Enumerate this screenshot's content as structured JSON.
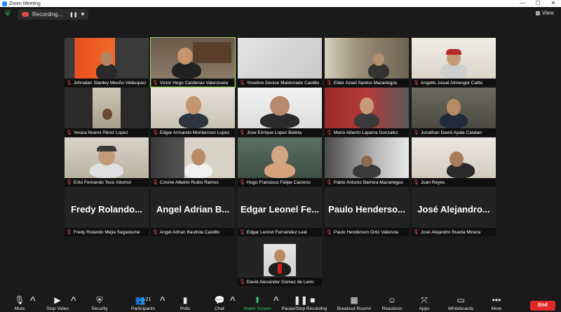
{
  "window": {
    "title": "Zoom Meeting",
    "minimize": "—",
    "maximize": "☐",
    "close": "✕"
  },
  "topbar": {
    "recording_label": "Recording...",
    "view_label": "View"
  },
  "participants": [
    {
      "name": "Johnatan Stanley Meoño Velásquez",
      "muted": true
    },
    {
      "name": "Victor Hugo Cardenas Valenzuela",
      "muted": true,
      "active": true
    },
    {
      "name": "Yoseline Denise Maldonado Castillo",
      "muted": true
    },
    {
      "name": "Elder Azael Santos Mazariegos",
      "muted": true
    },
    {
      "name": "Angello Josué Almengor Calito",
      "muted": true
    },
    {
      "name": "Yesica Noemi Pérez Lopez",
      "muted": true
    },
    {
      "name": "Edgar Armando Monterroso Lopez",
      "muted": true
    },
    {
      "name": "Jose Enrique Lopez Beteta",
      "muted": true
    },
    {
      "name": "Mario Alberto Laparra Gonzalez",
      "muted": true
    },
    {
      "name": "Jonathan David Ayala Catalan",
      "muted": true
    },
    {
      "name": "Erito Fernando Tecú Xitumul",
      "muted": true
    },
    {
      "name": "Cosme Alberto Rubio Ramos",
      "muted": true
    },
    {
      "name": "Hugo Francisco Felipe Caceros",
      "muted": true
    },
    {
      "name": "Pablo Antonio Barrera Mazariegos",
      "muted": true
    },
    {
      "name": "Juan Reyes",
      "muted": true
    },
    {
      "name": "Fredy Rolando Mejia Sagastume",
      "big": "Fredy Rolando...",
      "muted": true
    },
    {
      "name": "Angel Adrian Bautista Castillo",
      "big": "Angel Adrian B...",
      "muted": true
    },
    {
      "name": "Edgar Leonel Fernández Leal",
      "big": "Edgar Leonel Fe...",
      "muted": true
    },
    {
      "name": "Paulo Henderson Ortiz Valencia",
      "big": "Paulo Henderso...",
      "muted": true
    },
    {
      "name": "José Alejandro Rueda Minera",
      "big": "José Alejandro...",
      "muted": true
    },
    {
      "name": "David Alexander Gómez de León",
      "muted": true
    }
  ],
  "toolbar": {
    "mute": "Mute",
    "stop_video": "Stop Video",
    "security": "Security",
    "participants": "Participants",
    "participants_count": "21",
    "polls": "Polls",
    "chat": "Chat",
    "share_screen": "Share Screen",
    "pause_recording": "Pause/Stop Recording",
    "breakout": "Breakout Rooms",
    "reactions": "Reactions",
    "apps": "Apps",
    "whiteboards": "Whiteboards",
    "more": "More",
    "end": "End"
  }
}
